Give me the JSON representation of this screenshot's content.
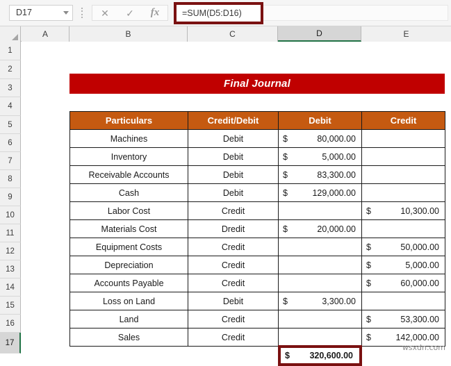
{
  "formula_bar": {
    "name_box_value": "D17",
    "cancel_icon": "close-icon",
    "cancel_glyph": "✕",
    "confirm_icon": "check-icon",
    "confirm_glyph": "✓",
    "function_icon": "fx-icon",
    "function_glyph": "fx",
    "formula_value": "=SUM(D5:D16)",
    "highlight_color": "#7a1111"
  },
  "grid": {
    "columns": [
      {
        "label": "A",
        "selected": false
      },
      {
        "label": "B",
        "selected": false
      },
      {
        "label": "C",
        "selected": false
      },
      {
        "label": "D",
        "selected": true
      },
      {
        "label": "E",
        "selected": false
      }
    ],
    "rows": [
      {
        "label": "1",
        "selected": false
      },
      {
        "label": "2",
        "selected": false
      },
      {
        "label": "3",
        "selected": false
      },
      {
        "label": "4",
        "selected": false
      },
      {
        "label": "5",
        "selected": false
      },
      {
        "label": "6",
        "selected": false
      },
      {
        "label": "7",
        "selected": false
      },
      {
        "label": "8",
        "selected": false
      },
      {
        "label": "9",
        "selected": false
      },
      {
        "label": "10",
        "selected": false
      },
      {
        "label": "11",
        "selected": false
      },
      {
        "label": "12",
        "selected": false
      },
      {
        "label": "13",
        "selected": false
      },
      {
        "label": "14",
        "selected": false
      },
      {
        "label": "15",
        "selected": false
      },
      {
        "label": "16",
        "selected": false
      },
      {
        "label": "17",
        "selected": true
      }
    ],
    "selection_accent": "#217346"
  },
  "journal": {
    "title": "Final Journal",
    "title_color": "#c00000",
    "header_color": "#c55a11",
    "headers": [
      "Particulars",
      "Credit/Debit",
      "Debit",
      "Credit"
    ],
    "currency_symbol": "$",
    "rows": [
      {
        "particulars": "Machines",
        "type": "Debit",
        "debit": "80,000.00",
        "credit": ""
      },
      {
        "particulars": "Inventory",
        "type": "Debit",
        "debit": "5,000.00",
        "credit": ""
      },
      {
        "particulars": "Receivable Accounts",
        "type": "Debit",
        "debit": "83,300.00",
        "credit": ""
      },
      {
        "particulars": "Cash",
        "type": "Debit",
        "debit": "129,000.00",
        "credit": ""
      },
      {
        "particulars": "Labor Cost",
        "type": "Credit",
        "debit": "",
        "credit": "10,300.00"
      },
      {
        "particulars": "Materials Cost",
        "type": "Dredit",
        "debit": "20,000.00",
        "credit": ""
      },
      {
        "particulars": "Equipment Costs",
        "type": "Credit",
        "debit": "",
        "credit": "50,000.00"
      },
      {
        "particulars": "Depreciation",
        "type": "Credit",
        "debit": "",
        "credit": "5,000.00"
      },
      {
        "particulars": "Accounts Payable",
        "type": "Credit",
        "debit": "",
        "credit": "60,000.00"
      },
      {
        "particulars": "Loss on Land",
        "type": "Debit",
        "debit": "3,300.00",
        "credit": ""
      },
      {
        "particulars": "Land",
        "type": "Credit",
        "debit": "",
        "credit": "53,300.00"
      },
      {
        "particulars": "Sales",
        "type": "Credit",
        "debit": "",
        "credit": "142,000.00"
      }
    ],
    "total": {
      "currency_symbol": "$",
      "amount": "320,600.00"
    }
  },
  "watermark": "wsxdn.com"
}
